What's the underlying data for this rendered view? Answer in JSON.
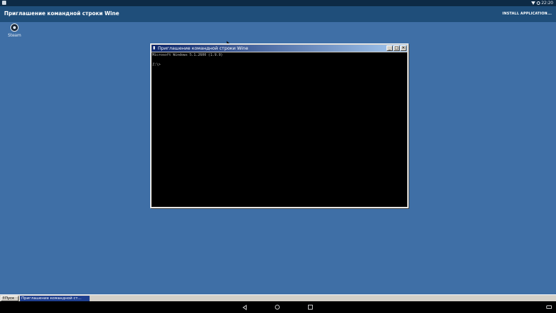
{
  "status_bar": {
    "time": "22:20",
    "icons": [
      "notification-icon",
      "wifi-icon",
      "alarm-icon"
    ]
  },
  "app_bar": {
    "title": "Приглашение командной строки Wine",
    "action_label": "INSTALL APPLICATION..."
  },
  "desktop": {
    "icons": [
      {
        "label": "Steam",
        "icon": "steam-icon"
      }
    ]
  },
  "console_window": {
    "title": "Приглашение командной строки Wine",
    "buttons": {
      "minimize": "_",
      "maximize": "□",
      "close": "✕"
    },
    "lines": [
      "Microsoft Windows 5.1.2600 (1.9.9)",
      "",
      "Z:\\>"
    ]
  },
  "taskbar": {
    "start_label": "Пуск",
    "task_label": "Приглашение командной ст..."
  },
  "nav_bar": {
    "icons": [
      "back-icon",
      "home-icon",
      "recents-icon",
      "keyboard-icon"
    ]
  },
  "colors": {
    "desktop": "#3f6fa6",
    "app_bar": "#1f4e7a",
    "status_bar": "#0d2a45",
    "console_bg": "#000000",
    "title_bar": "#0a246a"
  }
}
